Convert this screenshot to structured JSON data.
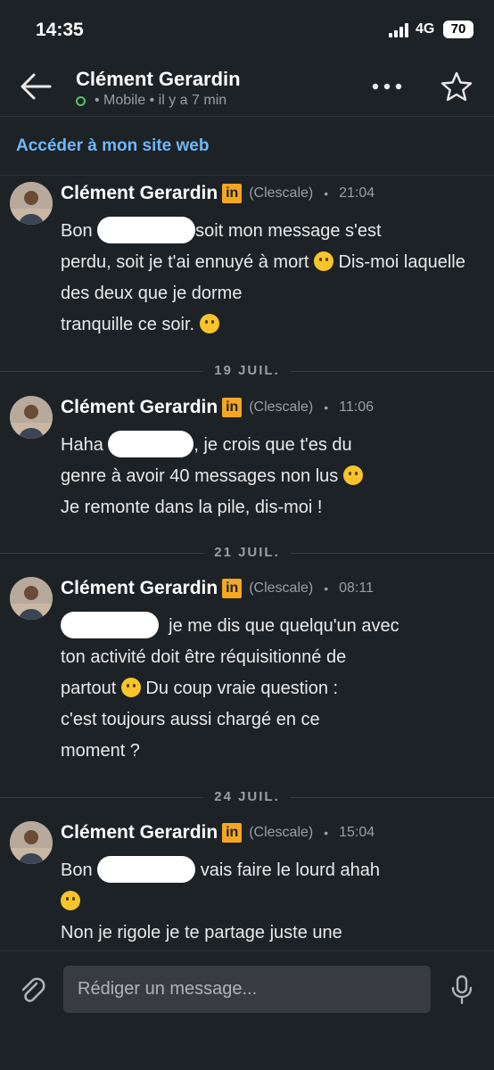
{
  "status_bar": {
    "time": "14:35",
    "network": "4G",
    "battery": "70"
  },
  "header": {
    "contact_name": "Clément Gerardin",
    "presence": "• Mobile • il y a 7 min",
    "icons": [
      "back-arrow-icon",
      "more-icon",
      "star-icon"
    ]
  },
  "website_link": "Accéder à mon site web",
  "messages": [
    {
      "sender": "Clément Gerardin",
      "badge": "in",
      "company": "(Clescale)",
      "dot": "•",
      "time": "21:04",
      "line1_a": "Bon ",
      "line1_b": "soit mon message s'est",
      "rest": "perdu, soit je t'ai ennuyé à mort",
      "rest2": "Dis-moi laquelle des deux que je dorme",
      "rest3": "tranquille ce soir."
    },
    {
      "sender": "Clément Gerardin",
      "badge": "in",
      "company": "(Clescale)",
      "dot": "•",
      "time": "11:06",
      "line1_a": "Haha ",
      "line1_b": ", je crois que t'es du",
      "rest": "genre à avoir 40 messages non lus",
      "rest2": "Je remonte dans la pile, dis-moi !"
    },
    {
      "sender": "Clément Gerardin",
      "badge": "in",
      "company": "(Clescale)",
      "dot": "•",
      "time": "08:11",
      "line1_b": "je me dis que quelqu'un avec",
      "rest": "ton activité doit être réquisitionné de",
      "rest2": "partout",
      "rest2b": "Du coup vraie question :",
      "rest3": "c'est toujours aussi chargé en ce",
      "rest4": "moment ?"
    },
    {
      "sender": "Clément Gerardin",
      "badge": "in",
      "company": "(Clescale)",
      "dot": "•",
      "time": "15:04",
      "line1_a": "Bon ",
      "line1_b": "vais faire le lourd ahah",
      "rest2": "Non je rigole je te partage juste une"
    }
  ],
  "day_separators": [
    "19 JUIL.",
    "21 JUIL.",
    "24 JUIL."
  ],
  "composer": {
    "placeholder": "Rédiger un message..."
  },
  "colors": {
    "background": "#1d2226",
    "link": "#71b7fb",
    "badge": "#f5a623",
    "online": "#57c26b"
  }
}
